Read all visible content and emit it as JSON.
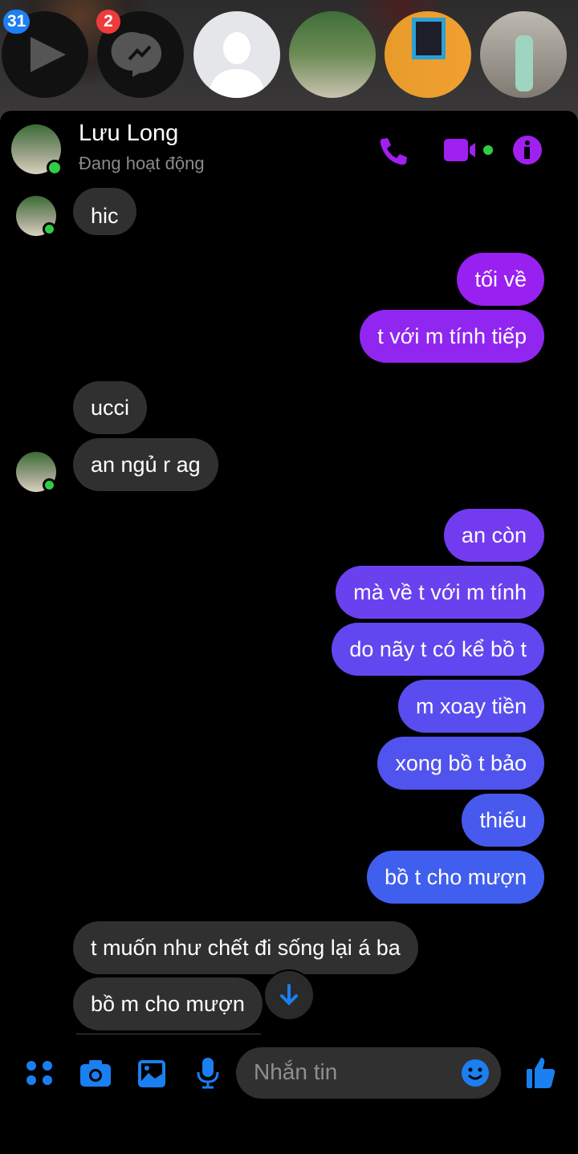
{
  "notifications": {
    "video_badge": "31",
    "messenger_badge": "2"
  },
  "header": {
    "name": "Lưu Long",
    "status": "Đang hoạt động"
  },
  "messages": [
    {
      "side": "recv",
      "text": "hic"
    },
    {
      "side": "sent",
      "text": "tối về"
    },
    {
      "side": "sent",
      "text": "t với m tính tiếp"
    },
    {
      "side": "recv",
      "text": "ucci"
    },
    {
      "side": "recv",
      "text": "an ngủ r ag"
    },
    {
      "side": "sent",
      "text": "an còn"
    },
    {
      "side": "sent",
      "text": "mà về t với m tính"
    },
    {
      "side": "sent",
      "text": "do nãy t có kể bồ t"
    },
    {
      "side": "sent",
      "text": "m xoay tiền"
    },
    {
      "side": "sent",
      "text": "xong bồ t bảo"
    },
    {
      "side": "sent",
      "text": "thiếu"
    },
    {
      "side": "sent",
      "text": "bồ t cho mượn"
    },
    {
      "side": "recv",
      "text": "t muốn như chết đi sống lại á ba"
    },
    {
      "side": "recv",
      "text": "bồ m cho mượn"
    }
  ],
  "composer": {
    "placeholder": "Nhắn tin"
  },
  "colors": {
    "accent_purple": "#a020f0",
    "accent_blue": "#1a7ff0",
    "sent_top": "#9a1ff0",
    "sent_bottom": "#3b62ee",
    "online": "#31cc46"
  }
}
